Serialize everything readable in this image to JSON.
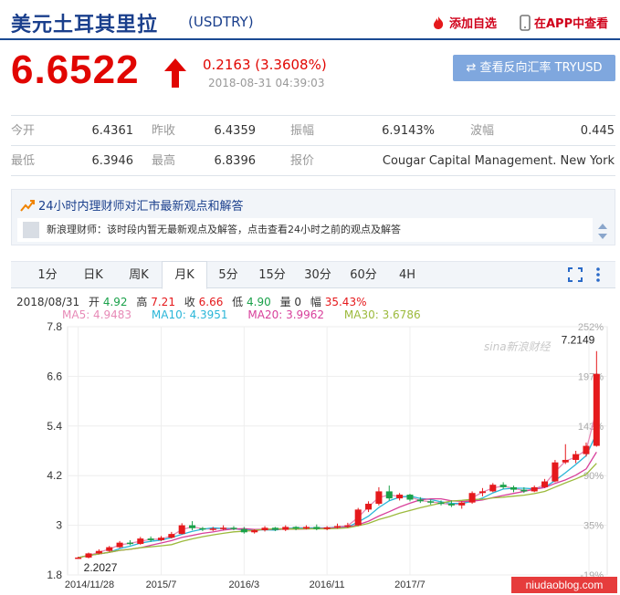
{
  "header": {
    "title": "美元土耳其里拉",
    "symbol": "(USDTRY)",
    "add_watch": "添加自选",
    "view_app": "在APP中查看"
  },
  "quote": {
    "price": "6.6522",
    "change": "0.2163 (3.3608%)",
    "timestamp": "2018-08-31 04:39:03",
    "reverse_button": "⇄ 查看反向汇率 TRYUSD"
  },
  "stats": [
    [
      {
        "label": "今开",
        "value": "6.4361"
      },
      {
        "label": "昨收",
        "value": "6.4359"
      },
      {
        "label": "振幅",
        "value": "6.9143%"
      },
      {
        "label": "波幅",
        "value": "0.445"
      }
    ],
    [
      {
        "label": "最低",
        "value": "6.3946"
      },
      {
        "label": "最高",
        "value": "6.8396"
      },
      {
        "label": "报价",
        "value": "Cougar Capital Management. New York"
      }
    ]
  ],
  "advice": {
    "heading": "24小时内理财师对汇市最新观点和解答",
    "message": "新浪理财师：该时段内暂无最新观点及解答，点击查看24小时之前的观点及解答"
  },
  "tabs": [
    "1分",
    "日K",
    "周K",
    "月K",
    "5分",
    "15分",
    "30分",
    "60分",
    "4H"
  ],
  "active_tab": "月K",
  "ohlc_line": {
    "date": "2018/08/31",
    "open_label": "开",
    "open": "4.92",
    "high_label": "高",
    "high": "7.21",
    "close_label": "收",
    "close": "6.66",
    "low_label": "低",
    "low": "4.90",
    "vol_label": "量",
    "vol": "0",
    "amp_label": "幅",
    "amp": "35.43%"
  },
  "ma_legend": [
    {
      "text": "MA5: 4.9483",
      "color": "#e78ab7"
    },
    {
      "text": "MA10: 4.3951",
      "color": "#2ab6d8"
    },
    {
      "text": "MA20: 3.9962",
      "color": "#d8409b"
    },
    {
      "text": "MA30: 3.6786",
      "color": "#9cba3c"
    }
  ],
  "colors": {
    "up": "#e5191c",
    "down": "#1aa14a",
    "accent": "#1a3f8c"
  },
  "chart_data": {
    "type": "candlestick",
    "y_ticks": [
      "7.8",
      "6.6",
      "5.4",
      "4.2",
      "3",
      "1.8"
    ],
    "y_range": [
      1.8,
      7.8
    ],
    "pct_ticks": [
      "252%",
      "197%",
      "143%",
      "90%",
      "35%",
      "-19%"
    ],
    "x_ticks": [
      "2014/11/28",
      "2015/7",
      "2016/3",
      "2016/11",
      "2017/7",
      "2018/8/31"
    ],
    "high_label": "7.2149",
    "low_label": "2.2027",
    "watermark": "sina新浪财经",
    "candles": [
      {
        "o": 2.21,
        "h": 2.24,
        "l": 2.2,
        "c": 2.22
      },
      {
        "o": 2.22,
        "h": 2.34,
        "l": 2.2,
        "c": 2.32
      },
      {
        "o": 2.32,
        "h": 2.42,
        "l": 2.3,
        "c": 2.38
      },
      {
        "o": 2.38,
        "h": 2.5,
        "l": 2.36,
        "c": 2.47
      },
      {
        "o": 2.47,
        "h": 2.62,
        "l": 2.45,
        "c": 2.58
      },
      {
        "o": 2.58,
        "h": 2.64,
        "l": 2.52,
        "c": 2.55
      },
      {
        "o": 2.55,
        "h": 2.72,
        "l": 2.53,
        "c": 2.68
      },
      {
        "o": 2.68,
        "h": 2.73,
        "l": 2.6,
        "c": 2.64
      },
      {
        "o": 2.64,
        "h": 2.74,
        "l": 2.62,
        "c": 2.7
      },
      {
        "o": 2.7,
        "h": 2.84,
        "l": 2.68,
        "c": 2.79
      },
      {
        "o": 2.79,
        "h": 3.05,
        "l": 2.78,
        "c": 3.0
      },
      {
        "o": 3.0,
        "h": 3.1,
        "l": 2.88,
        "c": 2.93
      },
      {
        "o": 2.93,
        "h": 2.96,
        "l": 2.86,
        "c": 2.9
      },
      {
        "o": 2.9,
        "h": 2.96,
        "l": 2.86,
        "c": 2.92
      },
      {
        "o": 2.92,
        "h": 3.0,
        "l": 2.88,
        "c": 2.94
      },
      {
        "o": 2.94,
        "h": 2.98,
        "l": 2.88,
        "c": 2.91
      },
      {
        "o": 2.91,
        "h": 2.96,
        "l": 2.8,
        "c": 2.83
      },
      {
        "o": 2.83,
        "h": 2.9,
        "l": 2.8,
        "c": 2.88
      },
      {
        "o": 2.88,
        "h": 2.98,
        "l": 2.85,
        "c": 2.94
      },
      {
        "o": 2.94,
        "h": 2.96,
        "l": 2.86,
        "c": 2.89
      },
      {
        "o": 2.89,
        "h": 3.0,
        "l": 2.86,
        "c": 2.96
      },
      {
        "o": 2.96,
        "h": 2.98,
        "l": 2.88,
        "c": 2.92
      },
      {
        "o": 2.92,
        "h": 3.0,
        "l": 2.9,
        "c": 2.96
      },
      {
        "o": 2.96,
        "h": 3.02,
        "l": 2.88,
        "c": 2.91
      },
      {
        "o": 2.91,
        "h": 2.98,
        "l": 2.88,
        "c": 2.95
      },
      {
        "o": 2.95,
        "h": 3.04,
        "l": 2.92,
        "c": 2.98
      },
      {
        "o": 2.98,
        "h": 3.06,
        "l": 2.94,
        "c": 3.0
      },
      {
        "o": 3.0,
        "h": 3.42,
        "l": 2.98,
        "c": 3.38
      },
      {
        "o": 3.38,
        "h": 3.58,
        "l": 3.32,
        "c": 3.52
      },
      {
        "o": 3.52,
        "h": 3.92,
        "l": 3.48,
        "c": 3.82
      },
      {
        "o": 3.82,
        "h": 3.96,
        "l": 3.6,
        "c": 3.65
      },
      {
        "o": 3.65,
        "h": 3.78,
        "l": 3.6,
        "c": 3.74
      },
      {
        "o": 3.74,
        "h": 3.76,
        "l": 3.58,
        "c": 3.62
      },
      {
        "o": 3.62,
        "h": 3.68,
        "l": 3.54,
        "c": 3.58
      },
      {
        "o": 3.58,
        "h": 3.62,
        "l": 3.5,
        "c": 3.55
      },
      {
        "o": 3.55,
        "h": 3.6,
        "l": 3.48,
        "c": 3.52
      },
      {
        "o": 3.52,
        "h": 3.6,
        "l": 3.44,
        "c": 3.48
      },
      {
        "o": 3.48,
        "h": 3.58,
        "l": 3.4,
        "c": 3.55
      },
      {
        "o": 3.55,
        "h": 3.82,
        "l": 3.52,
        "c": 3.78
      },
      {
        "o": 3.78,
        "h": 3.9,
        "l": 3.7,
        "c": 3.82
      },
      {
        "o": 3.82,
        "h": 4.02,
        "l": 3.8,
        "c": 3.98
      },
      {
        "o": 3.98,
        "h": 4.04,
        "l": 3.88,
        "c": 3.92
      },
      {
        "o": 3.92,
        "h": 3.96,
        "l": 3.8,
        "c": 3.86
      },
      {
        "o": 3.86,
        "h": 3.92,
        "l": 3.78,
        "c": 3.82
      },
      {
        "o": 3.82,
        "h": 3.96,
        "l": 3.8,
        "c": 3.92
      },
      {
        "o": 3.92,
        "h": 4.12,
        "l": 3.9,
        "c": 4.06
      },
      {
        "o": 4.06,
        "h": 4.58,
        "l": 4.04,
        "c": 4.52
      },
      {
        "o": 4.52,
        "h": 4.96,
        "l": 4.48,
        "c": 4.58
      },
      {
        "o": 4.58,
        "h": 4.8,
        "l": 4.5,
        "c": 4.72
      },
      {
        "o": 4.72,
        "h": 5.0,
        "l": 4.66,
        "c": 4.92
      },
      {
        "o": 4.92,
        "h": 7.21,
        "l": 4.9,
        "c": 6.66
      }
    ]
  }
}
